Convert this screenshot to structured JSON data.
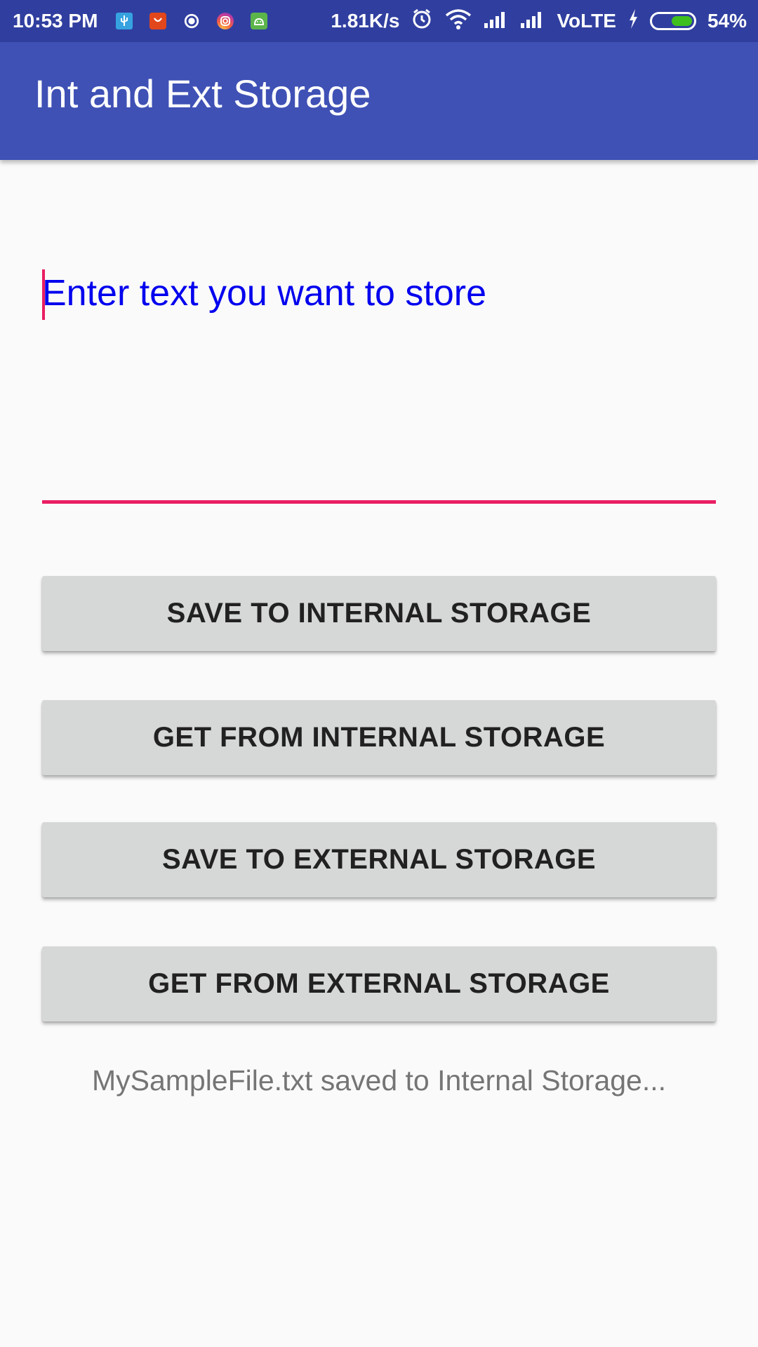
{
  "status_bar": {
    "time": "10:53 PM",
    "net_speed": "1.81K/s",
    "network": "VoLTE",
    "battery_percent": "54%",
    "battery_level": 0.54,
    "notification_icons": [
      "usb-icon",
      "shopping-icon",
      "whatsapp-icon",
      "instagram-icon",
      "android-icon"
    ]
  },
  "app_bar": {
    "title": "Int and Ext Storage",
    "color": "#3f51b5"
  },
  "input": {
    "placeholder": "Enter text you want to store",
    "value": "",
    "accent_color": "#e91e63"
  },
  "buttons": {
    "save_internal": "SAVE TO INTERNAL STORAGE",
    "get_internal": "GET FROM INTERNAL STORAGE",
    "save_external": "SAVE TO EXTERNAL STORAGE",
    "get_external": "GET FROM EXTERNAL STORAGE"
  },
  "message": "MySampleFile.txt saved to Internal Storage..."
}
